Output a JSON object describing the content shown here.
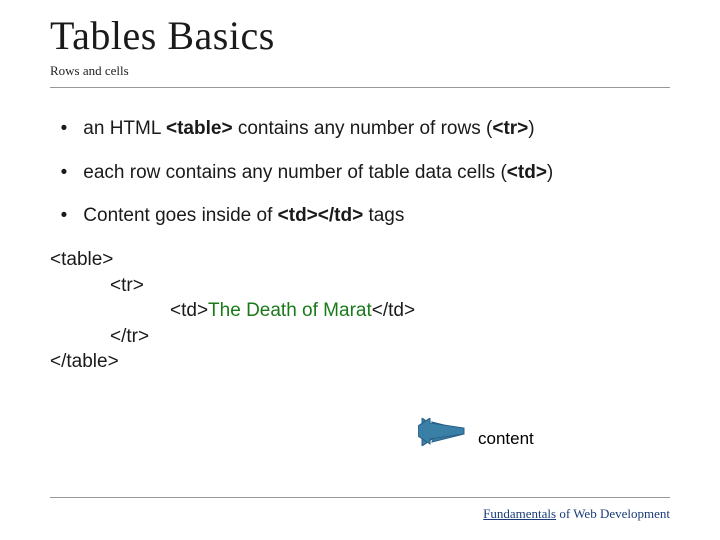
{
  "title": "Tables Basics",
  "subtitle": "Rows and cells",
  "bullets": [
    {
      "pre": "an HTML ",
      "strong": "<table>",
      "post": " contains any number of rows (",
      "strong2": "<tr>",
      "post2": ")"
    },
    {
      "pre": "each row contains any number of table data cells (",
      "strong": "<td>",
      "post": ")"
    },
    {
      "pre": "Content goes inside of ",
      "strong": "<td></td>",
      "post": " tags"
    }
  ],
  "code": {
    "open_table": "<table>",
    "open_tr": "<tr>",
    "td_open": "<td>",
    "td_content": "The Death of Marat",
    "td_close": "</td>",
    "close_tr": "</tr>",
    "close_table": "</table>"
  },
  "annotation": "content",
  "footer": {
    "underlined": "Fundamentals",
    "rest": " of Web Development"
  }
}
